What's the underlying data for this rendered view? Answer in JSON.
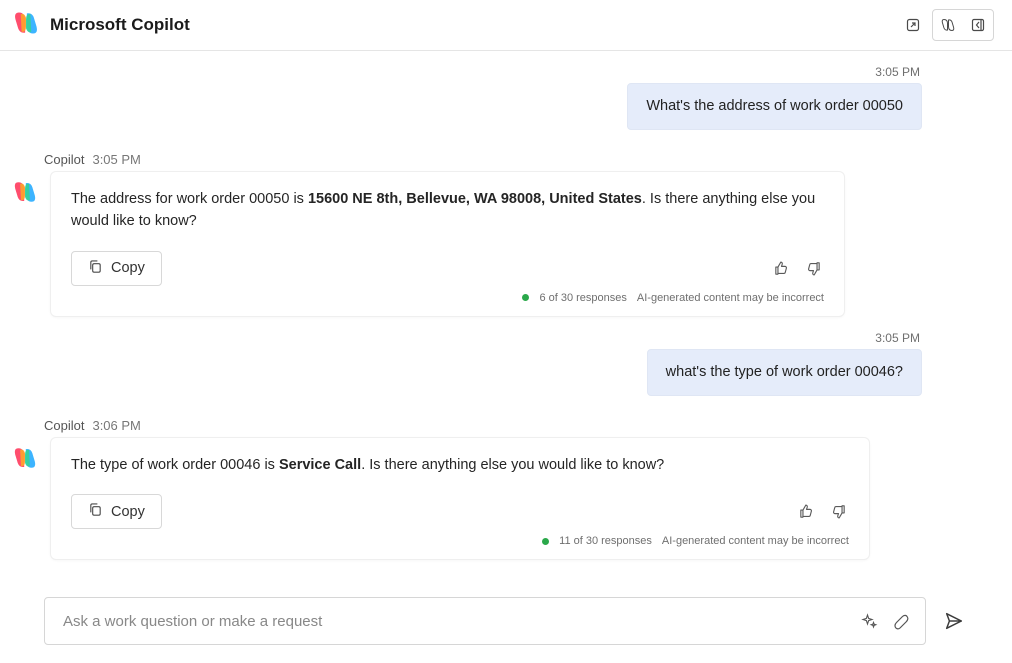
{
  "header": {
    "title": "Microsoft Copilot"
  },
  "messages": {
    "user1": {
      "time": "3:05 PM",
      "text": "What's the address of work order 00050"
    },
    "bot1": {
      "name": "Copilot",
      "time": "3:05 PM",
      "pre": "The address for work order 00050 is ",
      "bold": "15600 NE 8th, Bellevue, WA 98008, United States",
      "post": ". Is there anything else you would like to know?",
      "copy": "Copy",
      "responses": "6 of 30 responses",
      "disclaimer": "AI-generated content may be incorrect"
    },
    "user2": {
      "time": "3:05 PM",
      "text": "what's the type of work order 00046?"
    },
    "bot2": {
      "name": "Copilot",
      "time": "3:06 PM",
      "pre": "The type of work order 00046 is ",
      "bold": "Service Call",
      "post": ". Is there anything else you would like to know?",
      "copy": "Copy",
      "responses": "11 of 30 responses",
      "disclaimer": "AI-generated content may be incorrect"
    }
  },
  "composer": {
    "placeholder": "Ask a work question or make a request"
  }
}
